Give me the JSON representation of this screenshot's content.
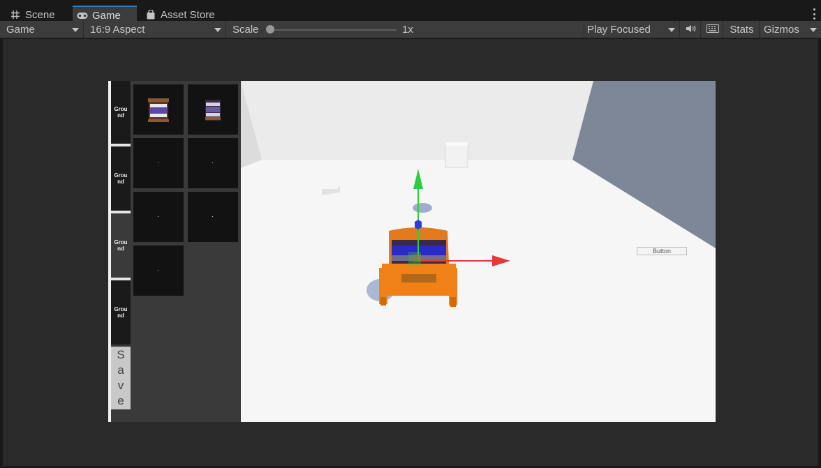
{
  "tabs": [
    {
      "label": "Scene",
      "icon": "grid-icon"
    },
    {
      "label": "Game",
      "icon": "gamepad-icon"
    },
    {
      "label": "Asset Store",
      "icon": "shopping-bag-icon"
    }
  ],
  "toolbar": {
    "display": "Game",
    "aspect": "16:9 Aspect",
    "scale_label": "Scale",
    "scale_value": "1x",
    "play_mode": "Play Focused",
    "stats_label": "Stats",
    "gizmos_label": "Gizmos"
  },
  "game_ui": {
    "ground_buttons": [
      "Grou\nnd",
      "Grou\nnd",
      "Grou\nnd",
      "Grou\nnd"
    ],
    "save_letters": [
      "S",
      "a",
      "v",
      "e"
    ],
    "button_label": "Button"
  },
  "colors": {
    "accent_tab": "#3a79bb",
    "gizmo_x": "#e53935",
    "gizmo_y": "#2ecc40",
    "gizmo_z": "#2a3fd8",
    "selection": "#ff7f0e"
  }
}
